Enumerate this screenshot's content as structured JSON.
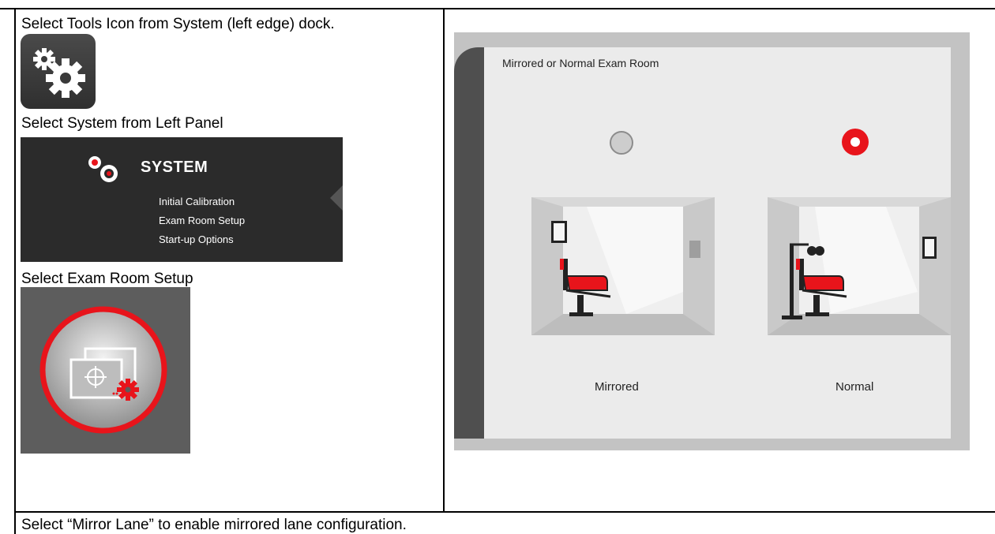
{
  "captions": {
    "step1": "Select Tools Icon from System (left edge) dock.",
    "step2": "Select System from Left Panel",
    "step3": "Select Exam Room Setup",
    "footer": "Select “Mirror Lane” to enable mirrored lane configuration."
  },
  "system_panel": {
    "title": "SYSTEM",
    "items": [
      "Initial Calibration",
      "Exam Room Setup",
      "Start-up Options"
    ]
  },
  "exam_room_screen": {
    "title": "Mirrored or Normal Exam Room",
    "options": [
      {
        "label": "Mirrored",
        "selected": false
      },
      {
        "label": "Normal",
        "selected": true
      }
    ]
  },
  "colors": {
    "accent_red": "#e8141b",
    "panel_dark": "#2b2b2b",
    "screen_bg": "#ebebeb"
  }
}
